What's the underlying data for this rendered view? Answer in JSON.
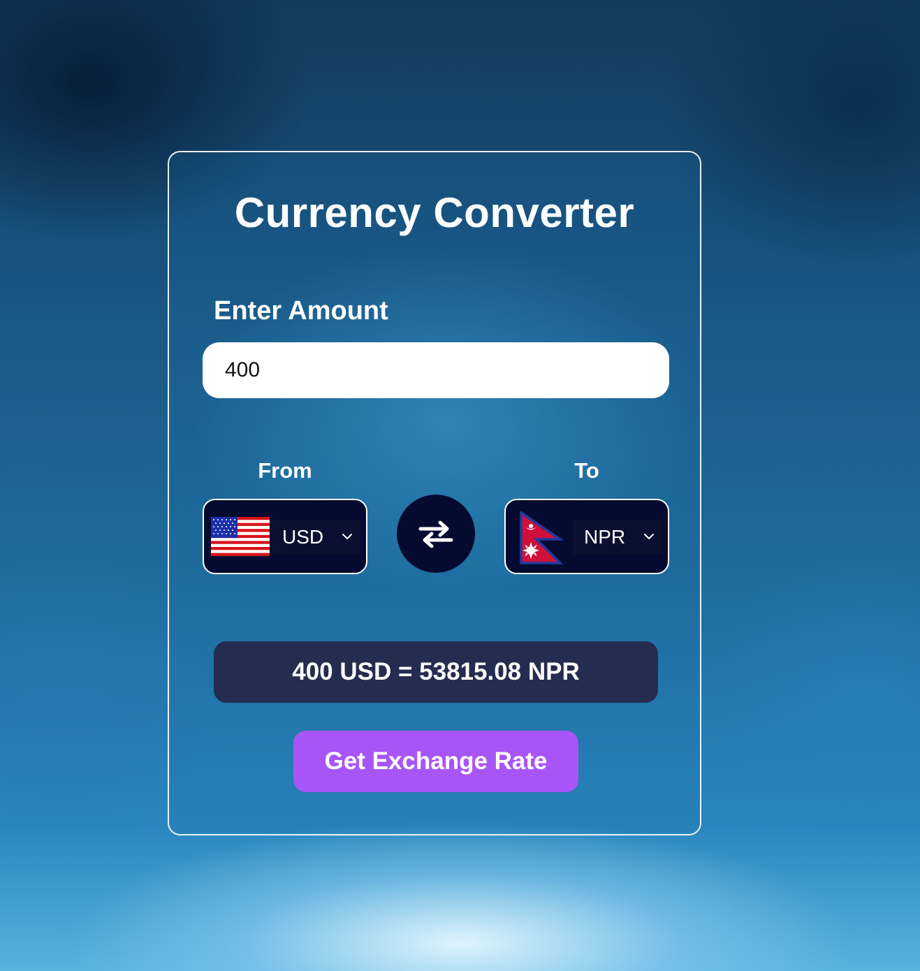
{
  "title": "Currency Converter",
  "amount": {
    "label": "Enter Amount",
    "value": "400"
  },
  "from": {
    "label": "From",
    "currency": "USD",
    "flag_icon": "us-flag-icon"
  },
  "to": {
    "label": "To",
    "currency": "NPR",
    "flag_icon": "nepal-flag-icon"
  },
  "swap_icon": "swap-arrows-icon",
  "result": "400 USD = 53815.08 NPR",
  "button": {
    "label": "Get Exchange Rate"
  },
  "colors": {
    "card_border": "#ffffff",
    "dark_navy": "#050b30",
    "result_bg": "#242d50",
    "button_purple": "#a855f7"
  }
}
